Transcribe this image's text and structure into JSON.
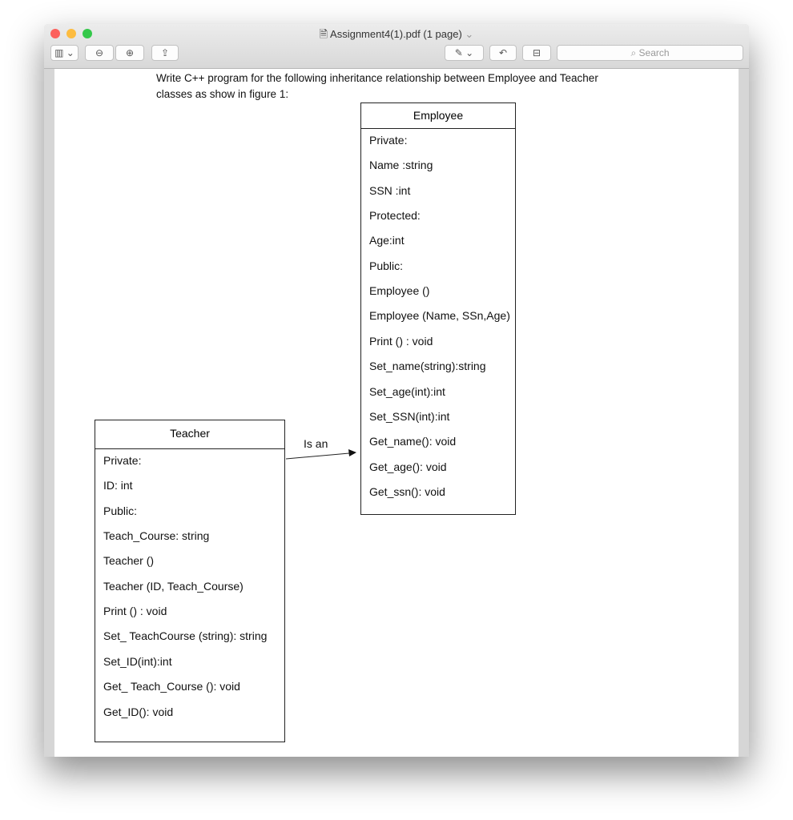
{
  "window": {
    "title": "Assignment4(1).pdf (1 page)",
    "search_placeholder": "Search"
  },
  "document": {
    "intro_line1": "Write C++ program for the following inheritance relationship between Employee and Teacher",
    "intro_line2": "classes as show in figure 1:",
    "relation_label": "Is an",
    "employee": {
      "name": "Employee",
      "members": [
        "Private:",
        "Name :string",
        "SSN :int",
        "Protected:",
        "Age:int",
        "Public:",
        "Employee ()",
        "Employee (Name, SSn,Age)",
        "Print () : void",
        "Set_name(string):string",
        "Set_age(int):int",
        "Set_SSN(int):int",
        "Get_name(): void",
        "Get_age(): void",
        "Get_ssn(): void"
      ]
    },
    "teacher": {
      "name": "Teacher",
      "members": [
        "Private:",
        "ID: int",
        "Public:",
        "Teach_Course: string",
        "Teacher ()",
        "Teacher (ID, Teach_Course)",
        "Print () : void",
        "Set_ TeachCourse (string): string",
        "Set_ID(int):int",
        "Get_ Teach_Course (): void",
        "Get_ID(): void"
      ]
    }
  }
}
